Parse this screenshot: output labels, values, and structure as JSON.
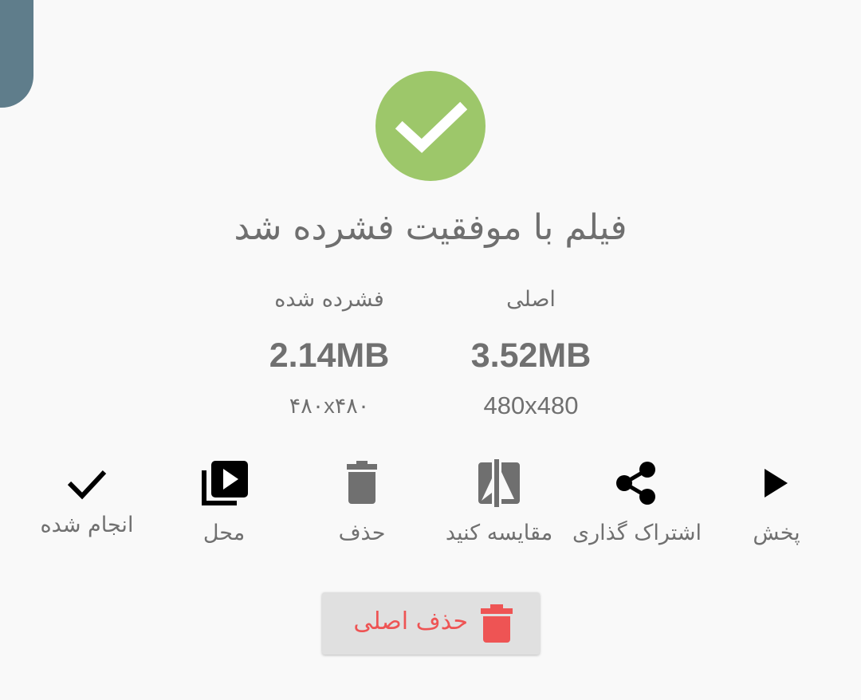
{
  "header": {
    "title": "فیلم با موفقیت فشرده شد"
  },
  "stats": {
    "original": {
      "label": "اصلی",
      "size": "3.52MB",
      "resolution": "480x480"
    },
    "compressed": {
      "label": "فشرده شده",
      "size": "2.14MB",
      "resolution": "۴۸۰x۴۸۰"
    }
  },
  "actions": {
    "play": {
      "label": "پخش",
      "icon": "play-icon"
    },
    "share": {
      "label": "اشتراک گذاری",
      "icon": "share-icon"
    },
    "compare": {
      "label": "مقایسه کنید",
      "icon": "compare-icon"
    },
    "delete": {
      "label": "حذف",
      "icon": "trash-icon"
    },
    "location": {
      "label": "محل",
      "icon": "video-library-icon"
    },
    "done": {
      "label": "انجام شده",
      "icon": "check-icon"
    }
  },
  "delete_original": {
    "label": "حذف اصلی",
    "icon": "trash-icon"
  },
  "colors": {
    "success": "#9dc76a",
    "danger": "#ee5454",
    "accent_tab": "#5f7d8b",
    "text": "#707070",
    "background": "#f9f9f9"
  }
}
